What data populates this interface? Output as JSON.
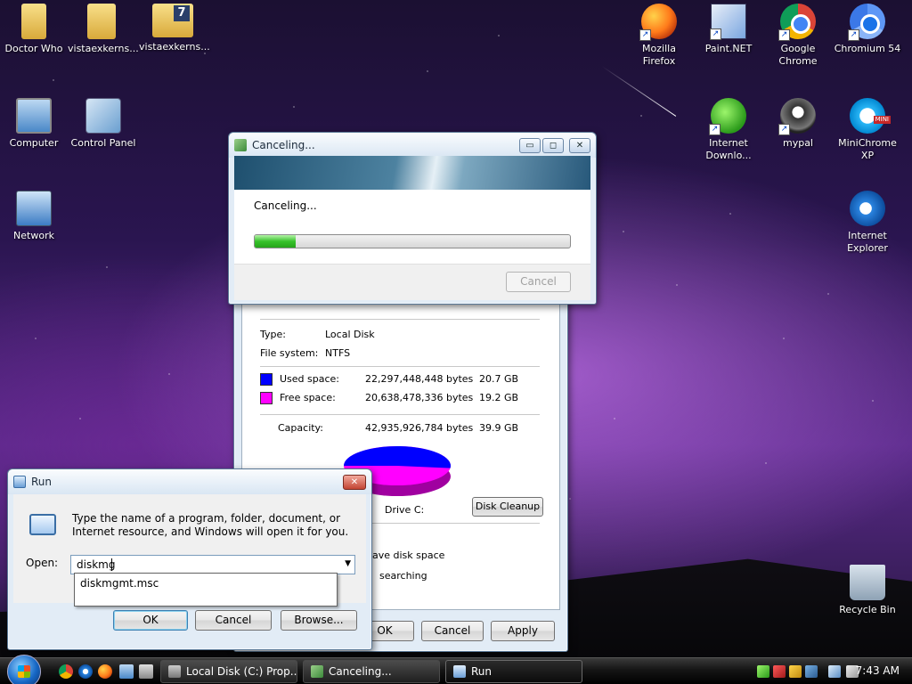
{
  "desktop": {
    "icons": [
      {
        "label": "Doctor Who"
      },
      {
        "label": "vistaexkerns..."
      },
      {
        "label": "vistaexkerns..."
      },
      {
        "label": "Computer"
      },
      {
        "label": "Control Panel"
      },
      {
        "label": "Network"
      },
      {
        "label": "Mozilla Firefox"
      },
      {
        "label": "Paint.NET"
      },
      {
        "label": "Google Chrome"
      },
      {
        "label": "Chromium 54"
      },
      {
        "label": "Internet Downlo..."
      },
      {
        "label": "mypal"
      },
      {
        "label": "MiniChrome XP"
      },
      {
        "label": "Internet Explorer"
      },
      {
        "label": "Recycle Bin"
      }
    ],
    "badge_seven": "7",
    "shortcut_arrow": "↗",
    "mini_badge": "MINI"
  },
  "cancel_dialog": {
    "title": "Canceling...",
    "status": "Canceling...",
    "progress_fraction": 0.13,
    "cancel_label": "Cancel",
    "min_glyph": "▭",
    "max_glyph": "◻",
    "close_glyph": "✕"
  },
  "properties": {
    "type_label": "Type:",
    "type_value": "Local Disk",
    "fs_label": "File system:",
    "fs_value": "NTFS",
    "used_label": "Used space:",
    "used_bytes": "22,297,448,448 bytes",
    "used_gb": "20.7 GB",
    "free_label": "Free space:",
    "free_bytes": "20,638,478,336 bytes",
    "free_gb": "19.2 GB",
    "capacity_label": "Capacity:",
    "capacity_bytes": "42,935,926,784 bytes",
    "capacity_gb": "39.9 GB",
    "drive_label": "Drive C:",
    "cleanup_label": "Disk Cleanup",
    "option1_partial": "ave disk space",
    "option2_partial": "searching",
    "ok_label": "OK",
    "cancel_label": "Cancel",
    "apply_label": "Apply",
    "used_color": "#0000ff",
    "free_color": "#ff00ff",
    "used_fraction": 0.519
  },
  "run_dialog": {
    "title": "Run",
    "close_glyph": "✕",
    "description": "Type the name of a program, folder, document, or Internet resource, and Windows will open it for you.",
    "open_label": "Open:",
    "input_value": "diskmg",
    "suggestion": "diskmgmt.msc",
    "ok_label": "OK",
    "cancel_label": "Cancel",
    "browse_label": "Browse..."
  },
  "taskbar": {
    "items": [
      {
        "label": "Local Disk (C:) Prop..."
      },
      {
        "label": "Canceling..."
      },
      {
        "label": "Run"
      }
    ],
    "clock": "7:43 AM"
  }
}
